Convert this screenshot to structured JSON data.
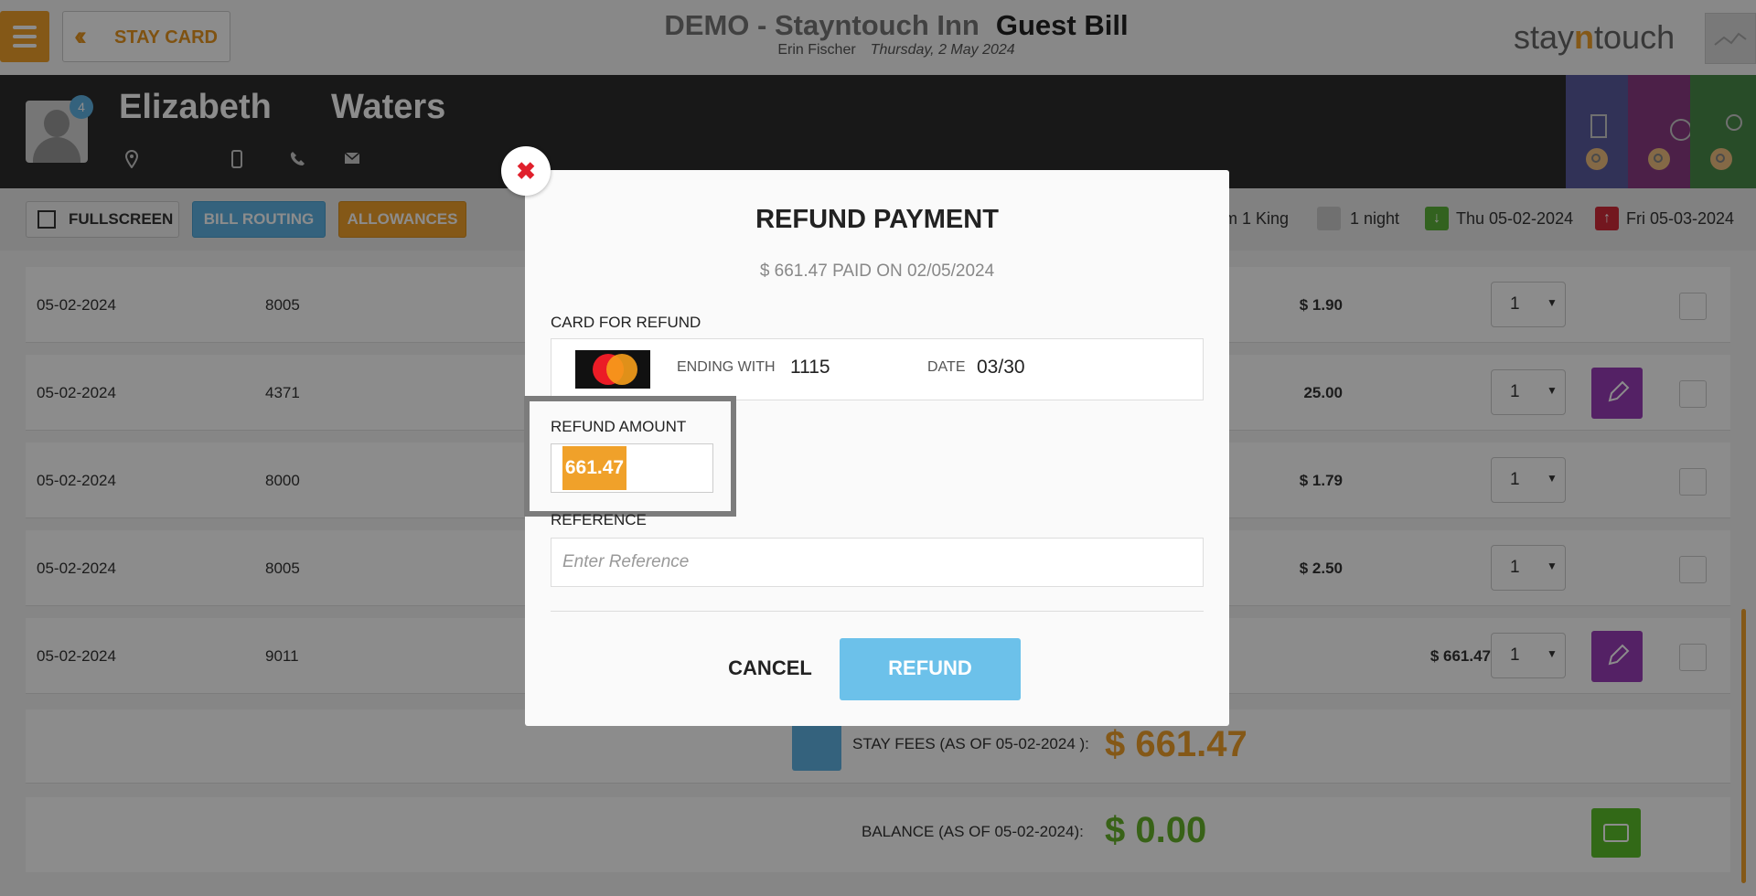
{
  "header": {
    "stay_card_label": "STAY CARD",
    "hotel_name": "DEMO - Stayntouch Inn",
    "page_title": "Guest Bill",
    "user": "Erin Fischer",
    "date": "Thursday, 2 May 2024",
    "logo_pre": "stay",
    "logo_n": "n",
    "logo_post": "touch"
  },
  "guest": {
    "first_name": "Elizabeth",
    "last_name": "Waters",
    "badge_count": "4"
  },
  "toolbar": {
    "fullscreen": "FULLSCREEN",
    "bill_routing": "BILL ROUTING",
    "allowances": "ALLOWANCES"
  },
  "stay_info": {
    "room": "m 1 King",
    "nights": "1 night",
    "arrival": "Thu 05-02-2024",
    "departure": "Fri 05-03-2024"
  },
  "rows": [
    {
      "date": "05-02-2024",
      "code": "8005",
      "amount": "$ 1.90",
      "qty": "1"
    },
    {
      "date": "05-02-2024",
      "code": "4371",
      "amount": "25.00",
      "qty": "1"
    },
    {
      "date": "05-02-2024",
      "code": "8000",
      "amount": "$ 1.79",
      "qty": "1"
    },
    {
      "date": "05-02-2024",
      "code": "8005",
      "amount": "$ 2.50",
      "qty": "1"
    },
    {
      "date": "05-02-2024",
      "code": "9011",
      "amount": "$ 661.47",
      "qty": "1"
    }
  ],
  "totals": {
    "stay_fees_label": "STAY FEES (AS OF  05-02-2024 ):",
    "stay_fees_value": "$ 661.47",
    "balance_label": "BALANCE (AS OF  05-02-2024):",
    "balance_value": "$ 0.00"
  },
  "modal": {
    "title": "REFUND PAYMENT",
    "subtitle": "$ 661.47 PAID ON 02/05/2024",
    "card_label": "CARD FOR REFUND",
    "ending_label": "ENDING WITH",
    "ending_value": "1115",
    "date_label": "DATE",
    "date_value": "03/30",
    "amount_label": "REFUND AMOUNT",
    "amount_value": "661.47",
    "reference_label": "REFERENCE",
    "reference_placeholder": "Enter Reference",
    "cancel": "CANCEL",
    "refund": "REFUND",
    "close_glyph": "✖"
  },
  "colors": {
    "accent_orange": "#f0a12a",
    "accent_blue": "#5fb3e4",
    "edit_purple": "#9a3cb8",
    "balance_green": "#66b22a"
  }
}
